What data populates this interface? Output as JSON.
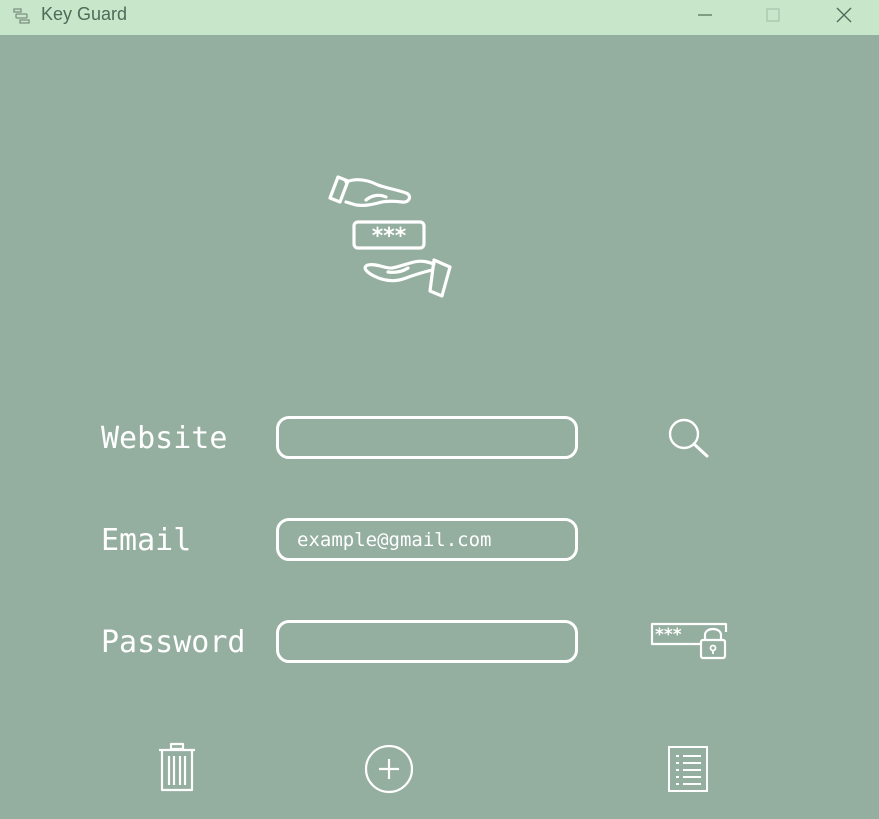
{
  "window": {
    "title": "Key Guard",
    "minimize_icon": "minimize-icon",
    "maximize_icon": "maximize-icon",
    "close_icon": "close-icon"
  },
  "hero": {
    "icon": "hands-password-icon",
    "icon_text": "***"
  },
  "form": {
    "website": {
      "label": "Website",
      "value": "",
      "placeholder": ""
    },
    "email": {
      "label": "Email",
      "value": "example@gmail.com",
      "placeholder": ""
    },
    "password": {
      "label": "Password",
      "value": "",
      "placeholder": ""
    }
  },
  "actions": {
    "search_icon": "search-icon",
    "generate_password_icon": "generate-password-icon",
    "generate_password_text": "***",
    "delete_icon": "trash-icon",
    "add_icon": "add-circle-icon",
    "list_icon": "list-icon"
  },
  "colors": {
    "background": "#94ae9f",
    "titlebar": "#c8e6c9",
    "foreground": "#ffffff",
    "title_text": "#4f6a58"
  }
}
